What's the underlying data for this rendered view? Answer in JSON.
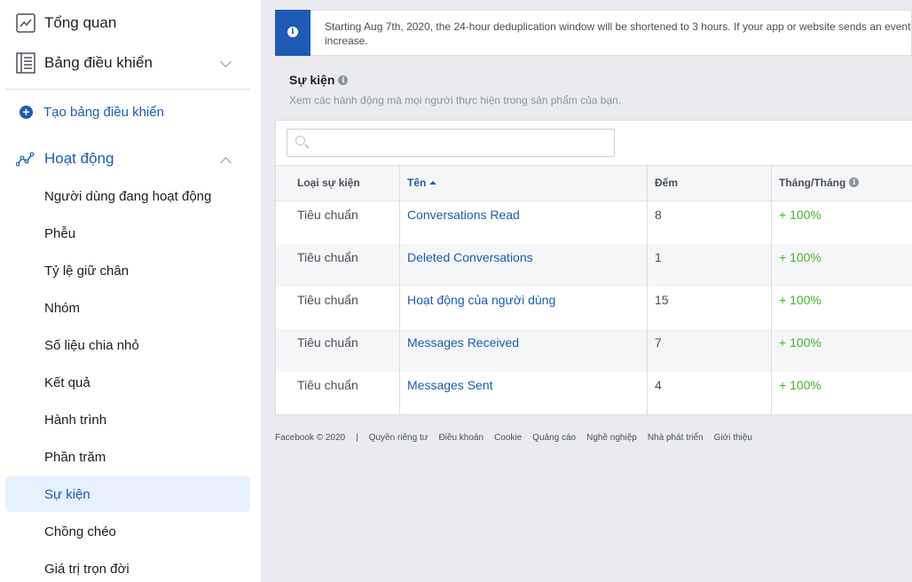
{
  "sidebar": {
    "overview": "Tổng quan",
    "dashboards": "Bảng điều khiển",
    "create_dashboard": "Tạo bảng điều khiển",
    "activity": "Hoạt động",
    "items": [
      "Người dùng đang hoạt động",
      "Phễu",
      "Tỷ lệ giữ chân",
      "Nhóm",
      "Số liệu chia nhỏ",
      "Kết quả",
      "Hành trình",
      "Phần trăm",
      "Sự kiện",
      "Chồng chéo",
      "Giá trị trọn đời"
    ],
    "active_item": "Sự kiện"
  },
  "notice": {
    "text": "Starting Aug 7th, 2020, the 24-hour deduplication window will be shortened to 3 hours. If your app or website sends an event increase."
  },
  "section": {
    "title": "Sự kiện",
    "subtitle": "Xem các hành động mà mọi người thực hiện trong sản phẩm của bạn."
  },
  "search": {
    "placeholder": ""
  },
  "table": {
    "headers": {
      "type": "Loại sự kiện",
      "name": "Tên",
      "count": "Đếm",
      "mom": "Tháng/Tháng"
    },
    "rows": [
      {
        "type": "Tiêu chuẩn",
        "name": "Conversations Read",
        "count": "8",
        "mom": "+ 100%"
      },
      {
        "type": "Tiêu chuẩn",
        "name": "Deleted Conversations",
        "count": "1",
        "mom": "+ 100%"
      },
      {
        "type": "Tiêu chuẩn",
        "name": "Hoạt động của người dùng",
        "count": "15",
        "mom": "+ 100%"
      },
      {
        "type": "Tiêu chuẩn",
        "name": "Messages Received",
        "count": "7",
        "mom": "+ 100%"
      },
      {
        "type": "Tiêu chuẩn",
        "name": "Messages Sent",
        "count": "4",
        "mom": "+ 100%"
      }
    ]
  },
  "footer": {
    "copyright": "Facebook © 2020",
    "separator": "|",
    "links": [
      "Quyền riêng tư",
      "Điều khoản",
      "Cookie",
      "Quảng cáo",
      "Nghề nghiệp",
      "Nhà phát triển",
      "Giới thiệu"
    ]
  }
}
